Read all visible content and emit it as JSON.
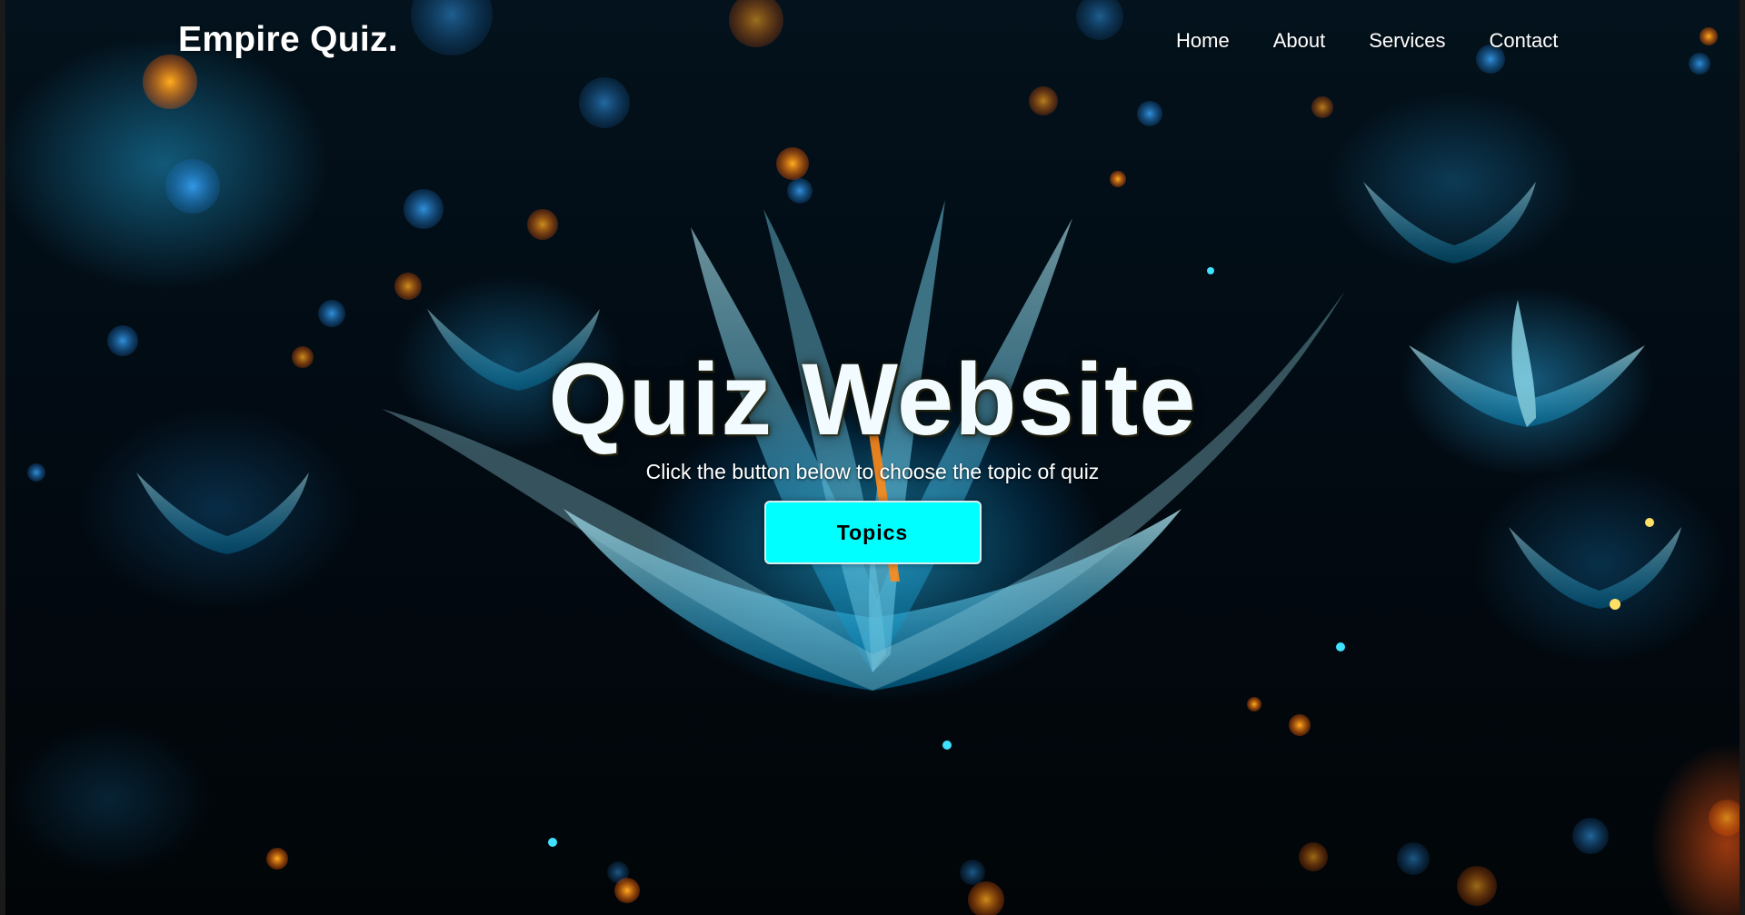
{
  "navbar": {
    "brand": "Empire Quiz.",
    "links": [
      {
        "label": "Home"
      },
      {
        "label": "About"
      },
      {
        "label": "Services"
      },
      {
        "label": "Contact"
      }
    ]
  },
  "hero": {
    "title": "Quiz Website",
    "subtitle": "Click the button below to choose the topic of quiz",
    "button_label": "Topics"
  },
  "colors": {
    "button_background": "#00ffff",
    "text": "#ffffff",
    "background": "#020a12"
  }
}
